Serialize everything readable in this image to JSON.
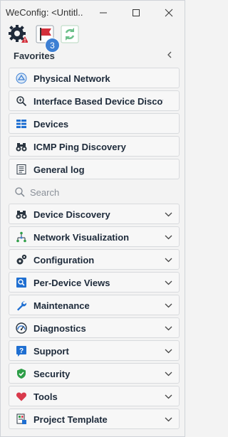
{
  "window": {
    "title": "WeConfig: <Untitl..."
  },
  "toolbar": {
    "notification_count": "3"
  },
  "favorites": {
    "title": "Favorites",
    "items": [
      {
        "label": "Physical Network",
        "icon": "physical-network-icon"
      },
      {
        "label": "Interface Based Device Discov...",
        "icon": "interface-discovery-icon"
      },
      {
        "label": "Devices",
        "icon": "devices-grid-icon"
      },
      {
        "label": "ICMP Ping Discovery",
        "icon": "binoculars-icon"
      },
      {
        "label": "General log",
        "icon": "log-icon"
      }
    ]
  },
  "search": {
    "placeholder": "Search"
  },
  "sections": [
    {
      "label": "Device Discovery",
      "icon": "binoculars-icon"
    },
    {
      "label": "Network Visualization",
      "icon": "network-tree-icon"
    },
    {
      "label": "Configuration",
      "icon": "gears-icon"
    },
    {
      "label": "Per-Device Views",
      "icon": "device-view-icon"
    },
    {
      "label": "Maintenance",
      "icon": "wrench-icon"
    },
    {
      "label": "Diagnostics",
      "icon": "gauge-icon"
    },
    {
      "label": "Support",
      "icon": "help-icon"
    },
    {
      "label": "Security",
      "icon": "shield-icon"
    },
    {
      "label": "Tools",
      "icon": "heart-icon"
    },
    {
      "label": "Project Template",
      "icon": "template-icon"
    }
  ],
  "colors": {
    "accent": "#3d7fd3",
    "flag": "#d32f3a",
    "security": "#2e9e48",
    "tools": "#d93a4c"
  }
}
